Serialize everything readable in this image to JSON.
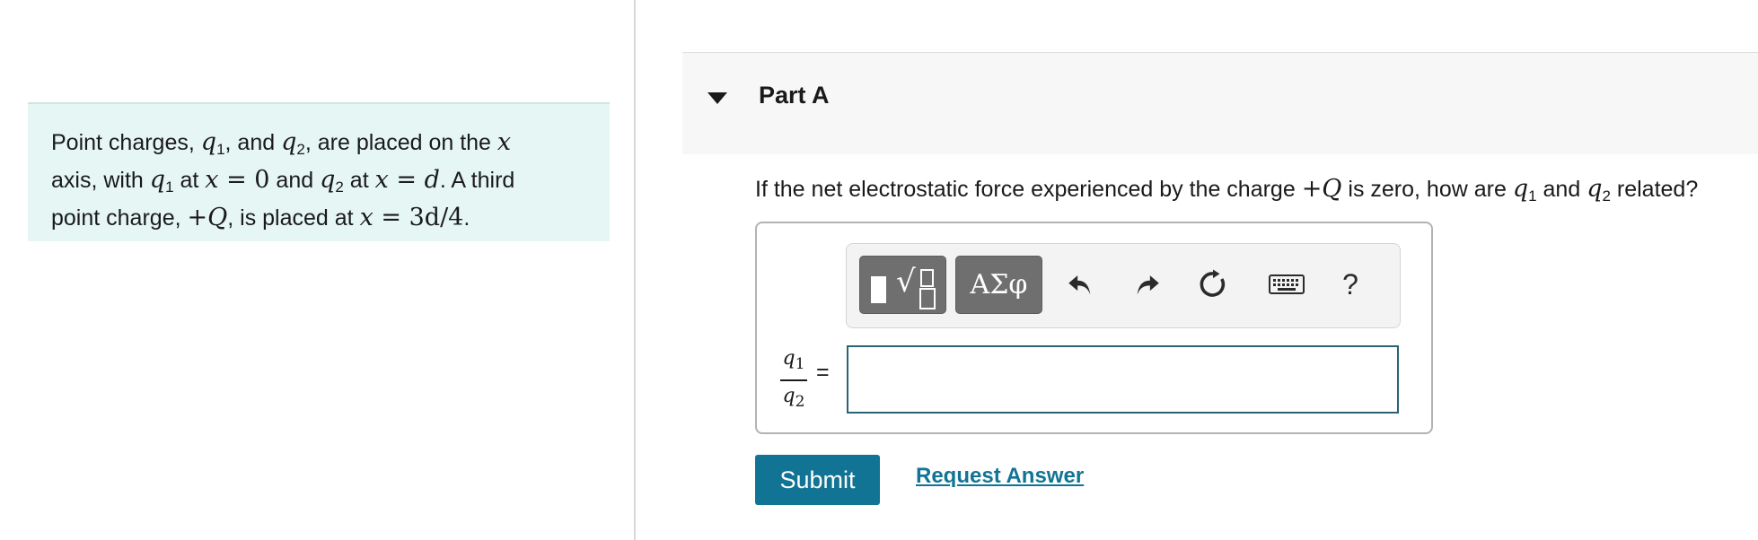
{
  "problem": {
    "t1": "Point charges, ",
    "q": "q",
    "s1": "1",
    "s2": "2",
    "t2": ", and ",
    "t3": ", are placed on the ",
    "x": "x",
    "t4": "axis, with ",
    "t5": " at ",
    "eq0": " = 0",
    "t6": " and ",
    "eqd": " = d",
    "t7": ". A third",
    "t8": "point charge, ",
    "plusQ": "+Q",
    "t9": ", is placed at ",
    "eq3d4": " = 3d/4",
    "t10": "."
  },
  "part": {
    "title": "Part A"
  },
  "question": {
    "t1": "If the net electrostatic force experienced by the charge ",
    "plusQ": "+Q",
    "t2": " is zero, how are ",
    "q": "q",
    "s1": "1",
    "s2": "2",
    "t3": " and ",
    "t4": " related?"
  },
  "toolbar": {
    "greek_label": "ΑΣφ",
    "help_label": "?",
    "icons": [
      "templates-icon",
      "greek-letters-icon",
      "undo-icon",
      "redo-icon",
      "reset-icon",
      "keyboard-icon",
      "help-icon"
    ]
  },
  "answer": {
    "fraction_num": "q",
    "fraction_num_sub": "1",
    "fraction_den": "q",
    "fraction_den_sub": "2",
    "equals": "=",
    "value": ""
  },
  "actions": {
    "submit_label": "Submit",
    "request_label": "Request Answer"
  },
  "colors": {
    "accent": "#127494",
    "problem_bg": "#e6f6f5",
    "input_border": "#2a6374"
  }
}
